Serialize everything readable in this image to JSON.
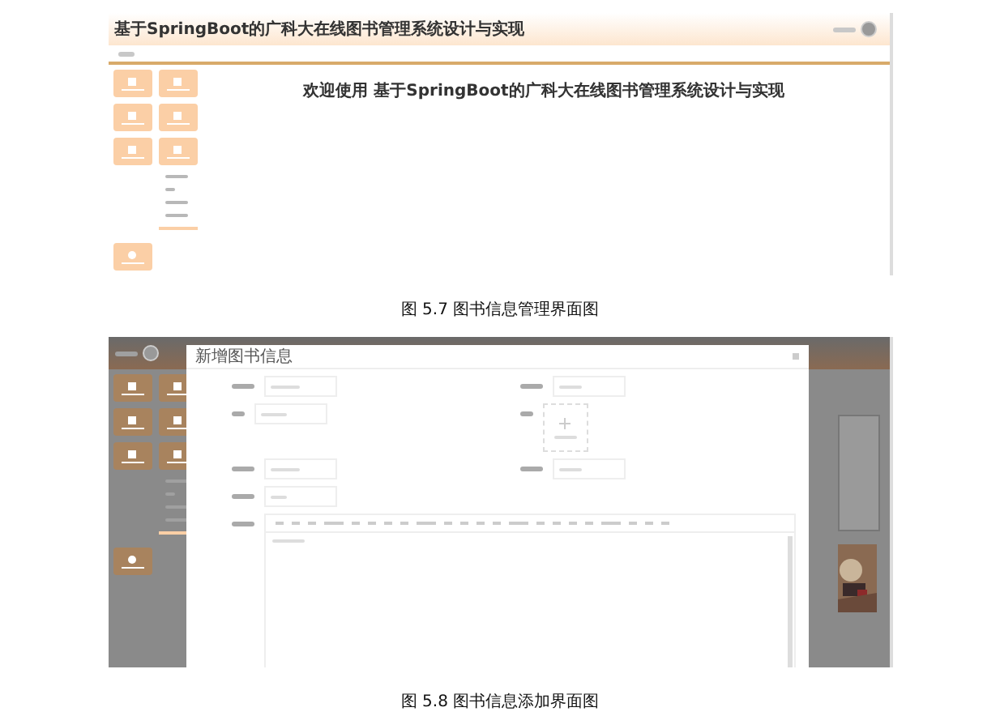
{
  "figures": [
    {
      "kind": "management",
      "header": {
        "title": "基于SpringBoot的广科大在线图书管理系统设计与实现"
      },
      "welcome": "欢迎使用 基于SpringBoot的广科大在线图书管理系统设计与实现",
      "caption": "图 5.7 图书信息管理界面图"
    },
    {
      "kind": "add_dialog",
      "dialog": {
        "title": "新增图书信息"
      },
      "caption": "图 5.8 图书信息添加界面图"
    }
  ]
}
